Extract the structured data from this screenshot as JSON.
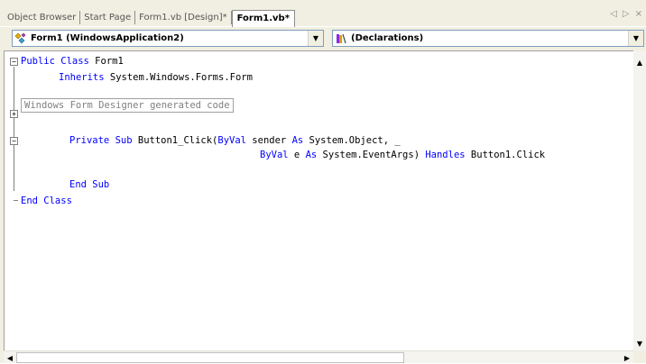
{
  "tabs": [
    {
      "label": "Object Browser"
    },
    {
      "label": "Start Page"
    },
    {
      "label": "Form1.vb [Design]*"
    },
    {
      "label": "Form1.vb*",
      "active": true
    }
  ],
  "tab_nav": {
    "prev": "◁",
    "next": "▷",
    "close": "×"
  },
  "class_combo": {
    "text": "Form1 (WindowsApplication2)",
    "icon": "class-icon"
  },
  "method_combo": {
    "text": "(Declarations)",
    "icon": "declarations-icon"
  },
  "code": {
    "public_kw": "Public Class",
    "class_name": " Form1",
    "inherits_kw": "Inherits",
    "inherits_target": " System.Windows.Forms.Form",
    "region": "Windows Form Designer generated code",
    "private_kw": "Private Sub",
    "sub_sig": " Button1_Click(",
    "byval1": "ByVal",
    "sender": " sender ",
    "as1": "As",
    "sender_type": " System.Object, _",
    "byval2": "ByVal",
    "e_param": " e ",
    "as2": "As",
    "e_type": " System.EventArgs) ",
    "handles_kw": "Handles",
    "handles_target": " Button1.Click",
    "end_sub": "End Sub",
    "end_class": "End Class"
  },
  "scroll": {
    "up": "▲",
    "down": "▼",
    "left": "◀",
    "right": "▶"
  },
  "colors": {
    "keyword": "#0000ff",
    "text": "#000000",
    "background": "#ffffff",
    "chrome": "#f1efe2"
  }
}
